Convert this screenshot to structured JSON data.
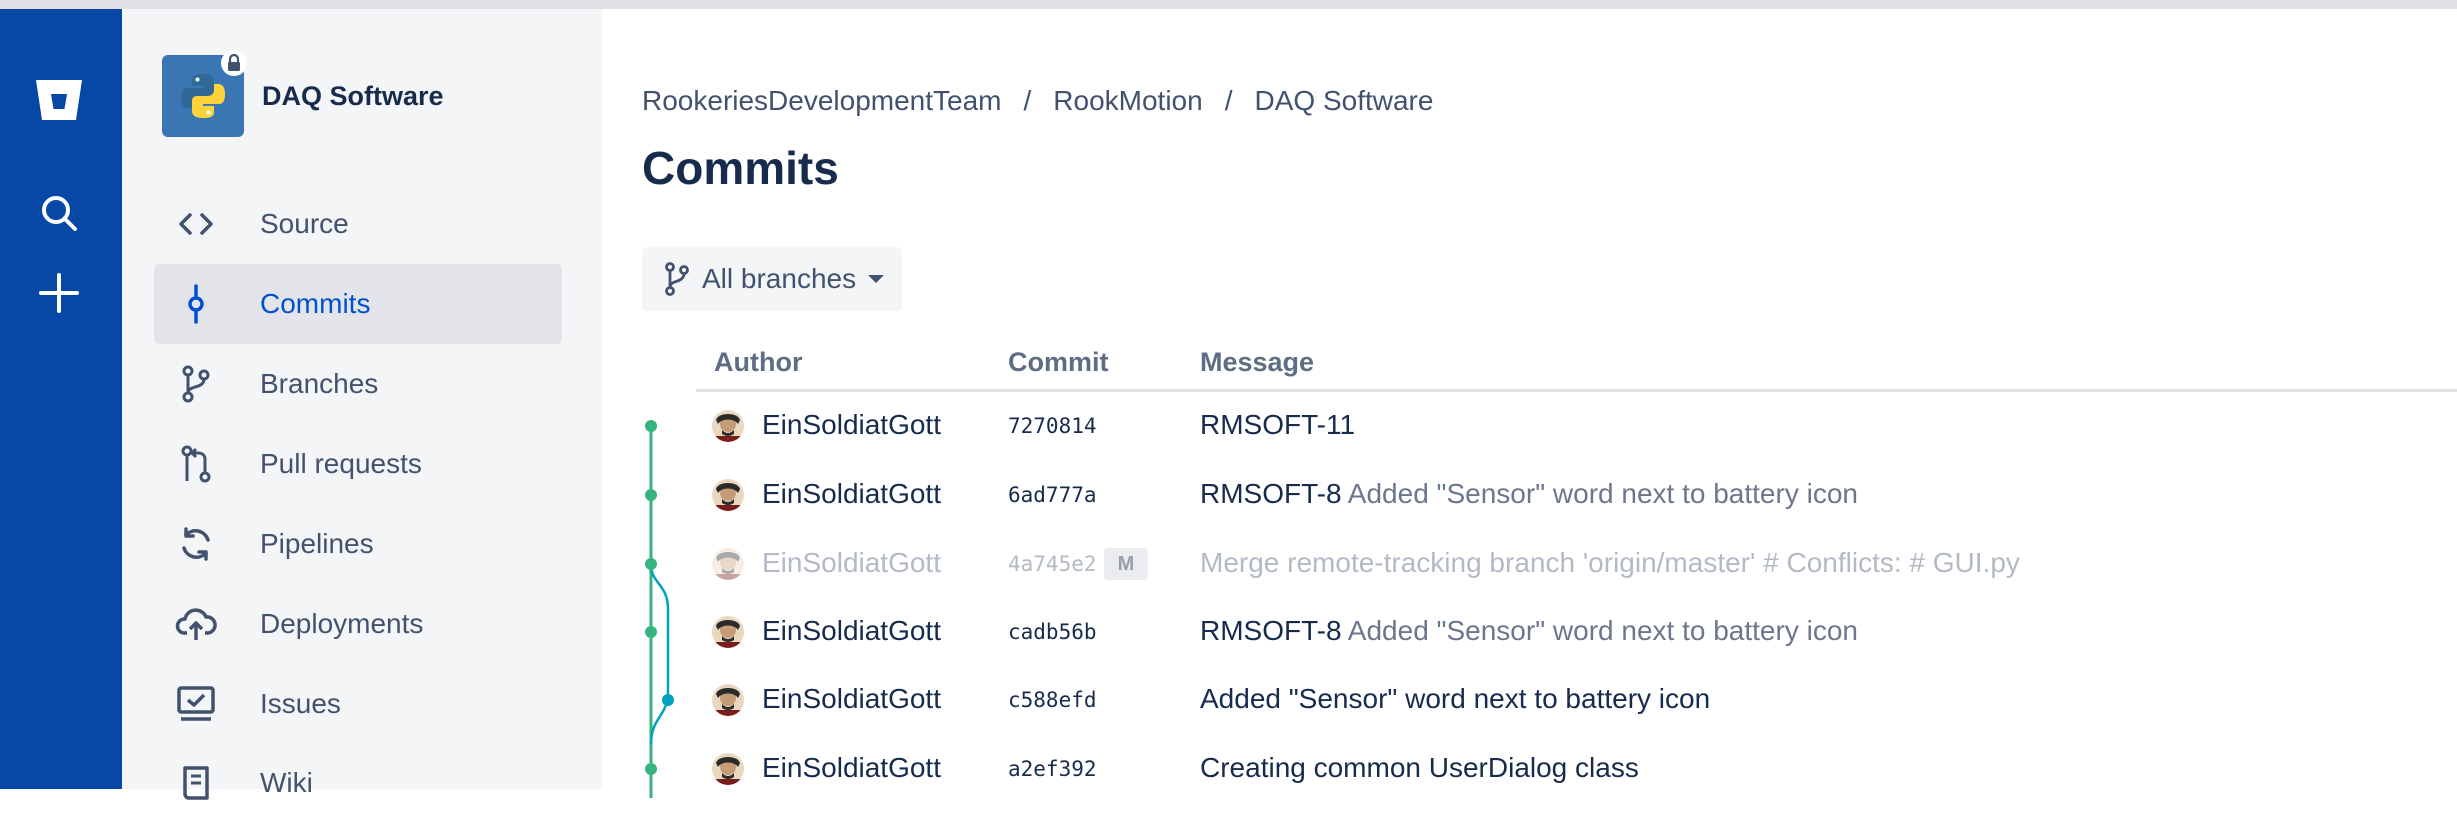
{
  "repo": {
    "name": "DAQ Software"
  },
  "sidebar": {
    "items": [
      {
        "label": "Source",
        "icon": "code-icon"
      },
      {
        "label": "Commits",
        "icon": "commit-icon",
        "active": true
      },
      {
        "label": "Branches",
        "icon": "branch-icon"
      },
      {
        "label": "Pull requests",
        "icon": "pull-request-icon"
      },
      {
        "label": "Pipelines",
        "icon": "pipelines-icon"
      },
      {
        "label": "Deployments",
        "icon": "cloud-upload-icon"
      },
      {
        "label": "Issues",
        "icon": "issues-icon"
      },
      {
        "label": "Wiki",
        "icon": "wiki-icon"
      }
    ]
  },
  "breadcrumb": [
    "RookeriesDevelopmentTeam",
    "RookMotion",
    "DAQ Software"
  ],
  "page": {
    "title": "Commits"
  },
  "branch_filter": {
    "label": "All branches"
  },
  "table": {
    "columns": {
      "author": "Author",
      "commit": "Commit",
      "message": "Message"
    },
    "rows": [
      {
        "author": "EinSoldiatGott",
        "hash": "7270814",
        "key": "RMSOFT-11",
        "rest": ""
      },
      {
        "author": "EinSoldiatGott",
        "hash": "6ad777a",
        "key": "RMSOFT-8",
        "rest": " Added \"Sensor\" word next to battery icon"
      },
      {
        "author": "EinSoldiatGott",
        "hash": "4a745e2",
        "badge": "M",
        "key": "Merge remote-tracking branch 'origin/master'",
        "rest": " # Conflicts: # GUI.py",
        "merge": true
      },
      {
        "author": "EinSoldiatGott",
        "hash": "cadb56b",
        "key": "RMSOFT-8",
        "rest": " Added \"Sensor\" word next to battery icon"
      },
      {
        "author": "EinSoldiatGott",
        "hash": "c588efd",
        "key": "Added \"Sensor\" word next to battery icon",
        "rest": ""
      },
      {
        "author": "EinSoldiatGott",
        "hash": "a2ef392",
        "key": "Creating common UserDialog class",
        "rest": ""
      }
    ]
  },
  "colors": {
    "global_nav": "#0747a6",
    "sidebar_bg": "#f4f5f7",
    "active_link": "#0052cc",
    "graph_main": "#36b37e",
    "graph_branch": "#00a3bf",
    "python_blue": "#3a76b4",
    "python_yellow": "#ffd43b"
  }
}
